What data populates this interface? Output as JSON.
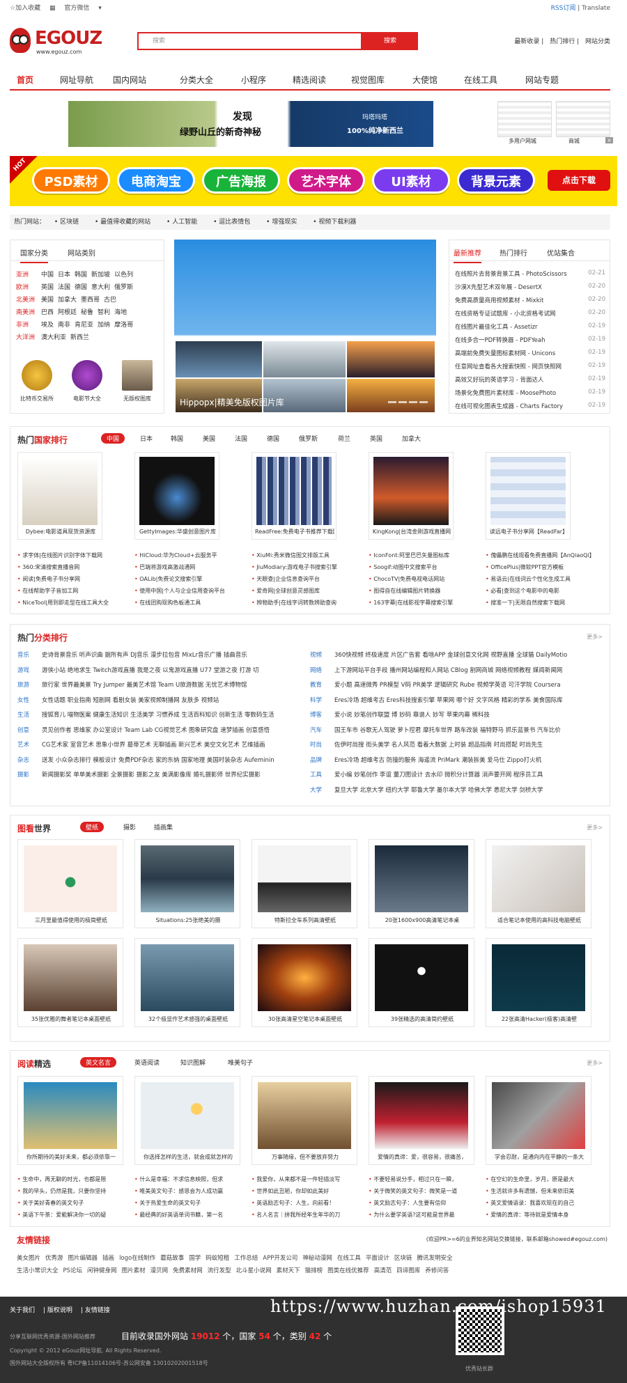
{
  "topbar": {
    "fav": "☆加入收藏",
    "wechat": "官方微信",
    "rss": "RSS订阅",
    "translate": "Translate"
  },
  "logo": {
    "name": "EGOUZ",
    "url": "www.egouz.com"
  },
  "search": {
    "placeholder": "搜索",
    "button": "搜索"
  },
  "header_links": [
    "最新收录",
    "热门排行",
    "网站分类"
  ],
  "nav": [
    "首页",
    "网址导航",
    "国内网站",
    "分类大全",
    "小程序",
    "精选阅读",
    "视觉图库",
    "大使馆",
    "在线工具",
    "网站专题"
  ],
  "ad1": {
    "t1": "发现",
    "t2": "绿野山丘的新奇神秘",
    "t3": "玛塔玛塔",
    "t4": "100%纯净新西兰",
    "r1": "多用户网城",
    "r2": "商城"
  },
  "ad2": {
    "hot": "HOT",
    "pills": [
      "PSD素材",
      "电商淘宝",
      "广告海报",
      "艺术字体",
      "UI素材",
      "背景元素"
    ],
    "download": "点击下载"
  },
  "hotbar": {
    "label": "热门网站：",
    "items": [
      "区块链",
      "最值得收藏的网站",
      "人工智能",
      "逗比表情包",
      "增强现实",
      "视频下载利器"
    ]
  },
  "country": {
    "tabs": [
      "国家分类",
      "网站类别"
    ],
    "rows": [
      {
        "k": "亚洲",
        "v": [
          "中国",
          "日本",
          "韩国",
          "新加坡",
          "以色列"
        ]
      },
      {
        "k": "欧洲",
        "v": [
          "英国",
          "法国",
          "德国",
          "意大利",
          "俄罗斯"
        ]
      },
      {
        "k": "北美洲",
        "v": [
          "美国",
          "加拿大",
          "墨西哥",
          "古巴"
        ]
      },
      {
        "k": "南美洲",
        "v": [
          "巴西",
          "阿根廷",
          "秘鲁",
          "智利",
          "海地"
        ]
      },
      {
        "k": "非洲",
        "v": [
          "埃及",
          "南非",
          "肯尼亚",
          "加纳",
          "摩洛哥"
        ]
      },
      {
        "k": "大洋洲",
        "v": [
          "澳大利亚",
          "新西兰"
        ]
      }
    ],
    "icons": [
      "比特币交易所",
      "电影节大全",
      "无版权图库"
    ]
  },
  "slider": {
    "caption": "Hippopx|精美免版权图片库"
  },
  "news": {
    "tabs": [
      "最新推荐",
      "热门排行",
      "优站集合"
    ],
    "items": [
      {
        "t": "在线照片去背景背景工具 - PhotoScissors",
        "d": "02-21"
      },
      {
        "t": "沙漠X先型艺术双年展 - DesertX",
        "d": "02-20"
      },
      {
        "t": "免费高质量商用视频素材 - Mixkit",
        "d": "02-20"
      },
      {
        "t": "在线资格专证试题库 - 小北资格考试网",
        "d": "02-20"
      },
      {
        "t": "在线图片最佳化工具 - Assetizr",
        "d": "02-19"
      },
      {
        "t": "在线多合一PDF转换器 - PDFYeah",
        "d": "02-19"
      },
      {
        "t": "高端前免费矢量图标素材网 - Unicons",
        "d": "02-19"
      },
      {
        "t": "任意网址查看各大搜索快照 - 网页快照网",
        "d": "02-19"
      },
      {
        "t": "高效又好玩的英语学习 - 背面达人",
        "d": "02-19"
      },
      {
        "t": "场景化免费图片素材库 - MoosePhoto",
        "d": "02-19"
      },
      {
        "t": "在线可视化图表生成器 - Charts Factory",
        "d": "02-19"
      }
    ]
  },
  "rank": {
    "title_a": "热门",
    "title_b": "国家排行",
    "tabs": [
      "中国",
      "日本",
      "韩国",
      "美国",
      "法国",
      "德国",
      "俄罗斯",
      "荷兰",
      "英国",
      "加拿大"
    ],
    "cards": [
      "Dybee:电影道具现货资源库",
      "GettyImages:华盛创意图片库",
      "ReadFree:免费电子书推荐下载网",
      "KingKong|台湾金刚游戏直播网",
      "读远电子书分享网【ReadFar】"
    ],
    "lists": [
      [
        "求字体|在线图片识别字体下载网",
        "360:宋清搜索直播音网",
        "阅读|免费电子书分享网",
        "在线帮助字子音加工网",
        "NiceTool|用到即走型在线工具大全"
      ],
      [
        "HiCloud:华为Cloud+云服务平",
        "巴端将游戏高激战通网",
        "OALib|免费论文搜索引擎",
        "使用中国|个人与企业信用查询平台",
        "在线团购现购色板通工具"
      ],
      [
        "XiuMi:秀米微信图文排版工具",
        "JiuModiary:游戏电子书搜索引擎",
        "天眼查|企业信息查询平台",
        "爱奇网|全球创意灵感图库",
        "辨物助手|在线字词转数辨助查询"
      ],
      [
        "IconFont:阿里巴巴矢量图标库",
        "Soogif:动图中文搜索平台",
        "ChocoTV|免费电视电话网站",
        "图得自在线编辑图片转换器",
        "163字幕|在线影视字幕搜索引擎"
      ],
      [
        "傀儡鹏在线观看免费直播网【AnQiaoQi】",
        "OfficePlus|微软PPT官方模板",
        "易语云|在线词云个性化生成工具",
        "必看|查到这个电影中的电影",
        "搜准一下|无限自然搜索下载网"
      ]
    ]
  },
  "cat": {
    "title_a": "热门",
    "title_b": "分类排行",
    "more": "更多>",
    "left": [
      {
        "k": "音乐",
        "v": "史诗背景音乐  听声识曲  据所有声  DJ音乐  漫步拉包音  MixLr音乐广播  插曲音乐"
      },
      {
        "k": "游戏",
        "v": "游侠小站  绝地求生  Twitch游戏直播  我是之夜  以鬼游戏直播  U77  堂游之夜  打游  切"
      },
      {
        "k": "旅游",
        "v": "旅行家  世界最美景  Try Jumper  最美艺术馆  Team U旅游数据  无忧艺术博物馆"
      },
      {
        "k": "女性",
        "v": "女性话题  职业指南  短剧网  看剧女装  美家视频制播网  友肤多  视频站"
      },
      {
        "k": "生活",
        "v": "搜狐育儿  喵物医案  健康生活知识  生活美学  习惯养成  生活百科知识  创新生活  零数码生活"
      },
      {
        "k": "创意",
        "v": "灵见创作者  思维家  办公室设计  Team Lab  CG视觉艺术  图象研究盘  速梦插画  创意感悟"
      },
      {
        "k": "艺术",
        "v": "CG艺术家  室音艺术  思象小世界  墓蒂艺术  无聊插画  新兴艺术  美空文化艺术  艺维插画"
      },
      {
        "k": "杂志",
        "v": "送发  小众杂志排行  模板设计  免费PDF杂志  家的东纳  国家地理  美国时装杂志  Aufeminin"
      },
      {
        "k": "摄影",
        "v": "新闻摄影奖  单单美术摄影  全景摄影  摄影之友  美满影像库  婚礼摄影师  世界纪实摄影"
      }
    ],
    "right": [
      {
        "k": "视频",
        "v": "360快视频  终极速度  片区广告套  看啥APP  金球创意文化网  视野直播  全球猫  DailyMotio"
      },
      {
        "k": "网络",
        "v": "上下游网站平台手段  播州网站编程和人网站  CBlog  割网商城  网络视频教程  媒阅新闻网"
      },
      {
        "k": "教育",
        "v": "爱小题  高速微秀  PR模型  V码  PR美学  逻辑研究  Rube  视频学英语  可汗学院  Coursera"
      },
      {
        "k": "科学",
        "v": "Eres冷场  超维考古  Eres科技搜索引擎  苹果网  哪个好  文字风格  精彩的学系 美食国际库"
      },
      {
        "k": "博客",
        "v": "爱小说  妙笔创作联盟  博  妙码  靠谱人  妙写  苹果内幕  稀科技"
      },
      {
        "k": "汽车",
        "v": "国王车市  谷歌无人驾驶  萝卜控君  摩托车世界  路车改装  福特野马  抓乐蓝景书  汽车比价"
      },
      {
        "k": "时尚",
        "v": "佐伊时尚搜  街头美学  名人风范  看着大数据  上时装  超品指南  时尚搭配  时尚先生"
      },
      {
        "k": "品牌",
        "v": "Eres冷场  超维考古  防撞的服务  海遥流  PriMark  潮装拆美  爱马仕  Zippo打火机"
      },
      {
        "k": "工具",
        "v": "爱小编  妙笔创作  李谊  董刀图设计  去水印  微积分计算器  消声要开网  程序员工具"
      },
      {
        "k": "大学",
        "v": "复旦大学  北京大学  纽约大学  耶鲁大学  墨尔本大学  哈佛大学  悉尼大学  剑桥大学"
      }
    ]
  },
  "photo": {
    "title_a": "图看",
    "title_b": "世界",
    "tabs": [
      "壁纸",
      "摄影",
      "插画集"
    ],
    "more": "更多>",
    "row1": [
      "三月里最值得使用的极简壁纸",
      "Situations:25张绝美的摄",
      "特斯拉全车系列高清壁纸",
      "20张1600x900高清笔记本桌",
      "适合笔记本使用的高科技电脑壁纸"
    ],
    "row2": [
      "35张优雅的舞者笔记本桌面壁纸",
      "32个极显作艺术感强的桌面壁纸",
      "30张高清星空笔记本桌面壁纸",
      "39张精选的高清简约壁纸",
      "22张高清Hacker(极客)高清壁"
    ]
  },
  "read": {
    "title_a": "阅读",
    "title_b": "精选",
    "tabs": [
      "英文名言",
      "英语阅读",
      "知识图解",
      "唯美句子"
    ],
    "more": "更多>",
    "cards": [
      "你所期待的美好未来，都必须依靠一",
      "你选择怎样的生活，就会成就怎样的",
      "万事随缘，但不要放弃努力",
      "爱情的真谛：爱，很容易，很痛苦，",
      "学会忍耐，是通向内在平静的一条大"
    ],
    "lists": [
      [
        "生命中，再无聊的时光，也都是限",
        "我的早头，仍然是我，只要你坚持",
        "关于美好青春的英文句子",
        "英语下午茶：爱能解决你一切的疑"
      ],
      [
        "什么是幸福：不求信息映照，但求",
        "唯美英文句子：感恩会为人成功赢",
        "关于热爱生命的英文句子",
        "最经典的好英语单词书籍，第一名"
      ],
      [
        "我爱你，从来都不是一件轻描淡写",
        "世界如此丑陋，你却如此美好",
        "英语励志句子：人生，向前看！",
        "名人名言｜拼我所经年生年华的刀"
      ],
      [
        "不要轻易说分手，相过只在一瞬，",
        "关于微笑的英文句子：微笑是一道",
        "英文励志句子：人生要有信仰",
        "为什么要学英语?这可能是世界最"
      ],
      [
        "在空幻的生命里，岁月，原是最大",
        "生活就许多有遗憾，但未来依旧美",
        "英文爱情语录：我喜欢现在的自己",
        "爱情的真谛：等待就是爱情本身"
      ]
    ]
  },
  "links": {
    "title": "友情链接",
    "note": "(欢迎PR>=6的业界知名网站交换链接，联系邮箱showed#egouz.com)",
    "line1": [
      "美女图片",
      "优秀游",
      "图片编辑器",
      "插画",
      "logo在线制作",
      "蘑菇故事",
      "国学",
      "码蚁短租",
      "工作总结",
      "APP开发公司",
      "神秘动漫网",
      "在线工具",
      "平面设计",
      "区块链",
      "腾讯发明安全"
    ],
    "line2": [
      "生活小常识大全",
      "PS论坛",
      "闲钟健身网",
      "图片素材",
      "漫贝网",
      "免费素材网",
      "流行发型",
      "北斗星小说网",
      "素材天下",
      "猫排榜",
      "图类在线优推荐",
      "高清范",
      "四谛图库",
      "养修问答"
    ]
  },
  "footer": {
    "links": [
      "关于我们",
      "版权说明",
      "友情链接"
    ],
    "sum_pre": "目前收录国外网站",
    "sites": "19012",
    "sum_mid": "个，国家",
    "countries": "54",
    "sum_mid2": "个，类别",
    "cats": "42",
    "sum_end": "个",
    "s1": "分享互联网优秀资源-国外网站推荐",
    "s2": "Copyright © 2012 eGouz网址导航. All Rights Reserved.",
    "s3": "国外网站大全版权所有 粤ICP备11014106号-苏公网安备 13010202001518号",
    "s4": "优秀站长群",
    "watermark": "https://www.huzhan.com/ishop15931"
  },
  "colors": {
    "accent": "#dd2222",
    "link": "#2a72c5",
    "footer_bg": "#303030",
    "banner_bg": "#ffe100"
  }
}
